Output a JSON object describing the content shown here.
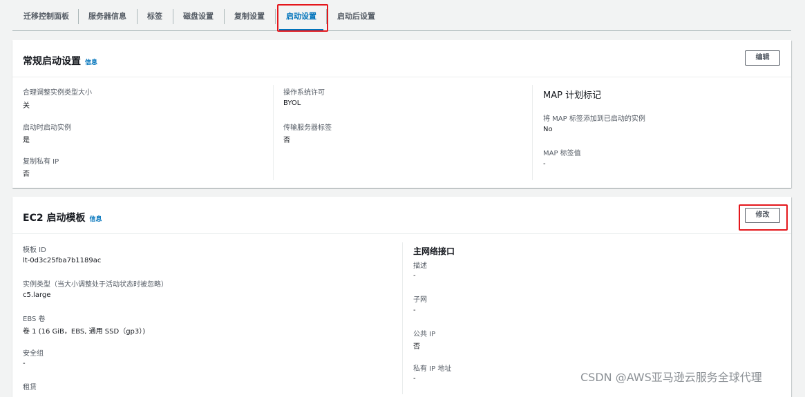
{
  "tabs": [
    {
      "label": "迁移控制面板",
      "active": false
    },
    {
      "label": "服务器信息",
      "active": false
    },
    {
      "label": "标签",
      "active": false
    },
    {
      "label": "磁盘设置",
      "active": false
    },
    {
      "label": "复制设置",
      "active": false
    },
    {
      "label": "启动设置",
      "active": true
    },
    {
      "label": "启动后设置",
      "active": false
    }
  ],
  "general": {
    "title": "常规启动设置",
    "info": "信息",
    "edit_label": "编辑",
    "col1": [
      {
        "label": "合理调整实例类型大小",
        "value": "关"
      },
      {
        "label": "启动时启动实例",
        "value": "是"
      },
      {
        "label": "复制私有 IP",
        "value": "否"
      }
    ],
    "col2": [
      {
        "label": "操作系统许可",
        "value": "BYOL"
      },
      {
        "label": "传输服务器标签",
        "value": "否"
      }
    ],
    "col3": {
      "heading": "MAP 计划标记",
      "fields": [
        {
          "label": "将 MAP 标签添加到已启动的实例",
          "value": "No"
        },
        {
          "label": "MAP 标签值",
          "value": "-"
        }
      ]
    }
  },
  "ec2": {
    "title": "EC2 启动模板",
    "info": "信息",
    "modify_label": "修改",
    "col1": [
      {
        "label": "模板 ID",
        "value": "lt-0d3c25fba7b1189ac"
      },
      {
        "label": "实例类型（当大小调整处于活动状态时被忽略）",
        "value": "c5.large"
      },
      {
        "label": "EBS 卷",
        "value": "卷 1 (16 GiB，EBS, 通用 SSD（gp3）)"
      },
      {
        "label": "安全组",
        "value": "-"
      },
      {
        "label": "租赁",
        "value": ""
      }
    ],
    "col2": {
      "heading": "主网络接口",
      "fields": [
        {
          "label": "描述",
          "value": "-"
        },
        {
          "label": "子网",
          "value": "-"
        },
        {
          "label": "公共 IP",
          "value": "否"
        },
        {
          "label": "私有 IP 地址",
          "value": "-"
        }
      ]
    }
  },
  "watermark": "CSDN @AWS亚马逊云服务全球代理",
  "colors": {
    "accent": "#0073bb",
    "highlight": "#e4161b"
  }
}
